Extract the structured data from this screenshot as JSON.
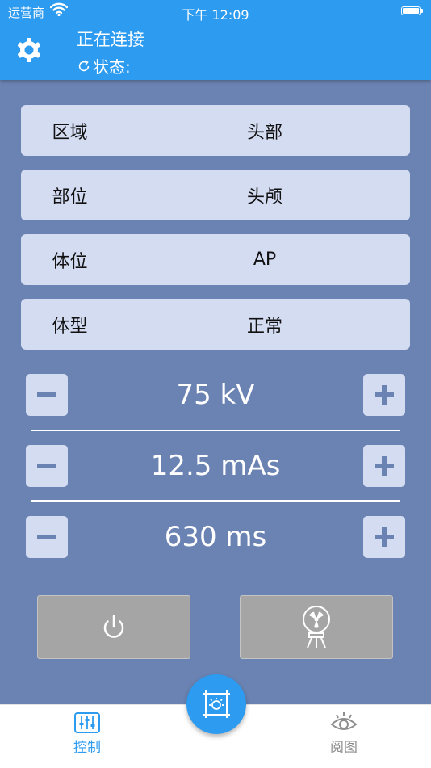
{
  "status_bar": {
    "carrier": "运营商",
    "time": "下午 12:09"
  },
  "header": {
    "title": "正在连接",
    "status_label": "状态:"
  },
  "rows": [
    {
      "label": "区域",
      "value": "头部"
    },
    {
      "label": "部位",
      "value": "头颅"
    },
    {
      "label": "体位",
      "value": "AP"
    },
    {
      "label": "体型",
      "value": "正常"
    }
  ],
  "params": [
    {
      "value": "75 kV"
    },
    {
      "value": "12.5 mAs"
    },
    {
      "value": "630 ms"
    }
  ],
  "tabs": {
    "control": "控制",
    "view": "阅图"
  },
  "colors": {
    "accent": "#2d9bf0",
    "background": "#6b83b2",
    "row": "#d4dcf2",
    "disabled": "#a5a5a5"
  },
  "icons": {
    "settings": "gear-icon",
    "refresh": "refresh-icon",
    "power": "power-icon",
    "exposure": "radiation-icon",
    "capture": "capture-frame-icon",
    "control": "sliders-icon",
    "view": "eye-icon"
  }
}
